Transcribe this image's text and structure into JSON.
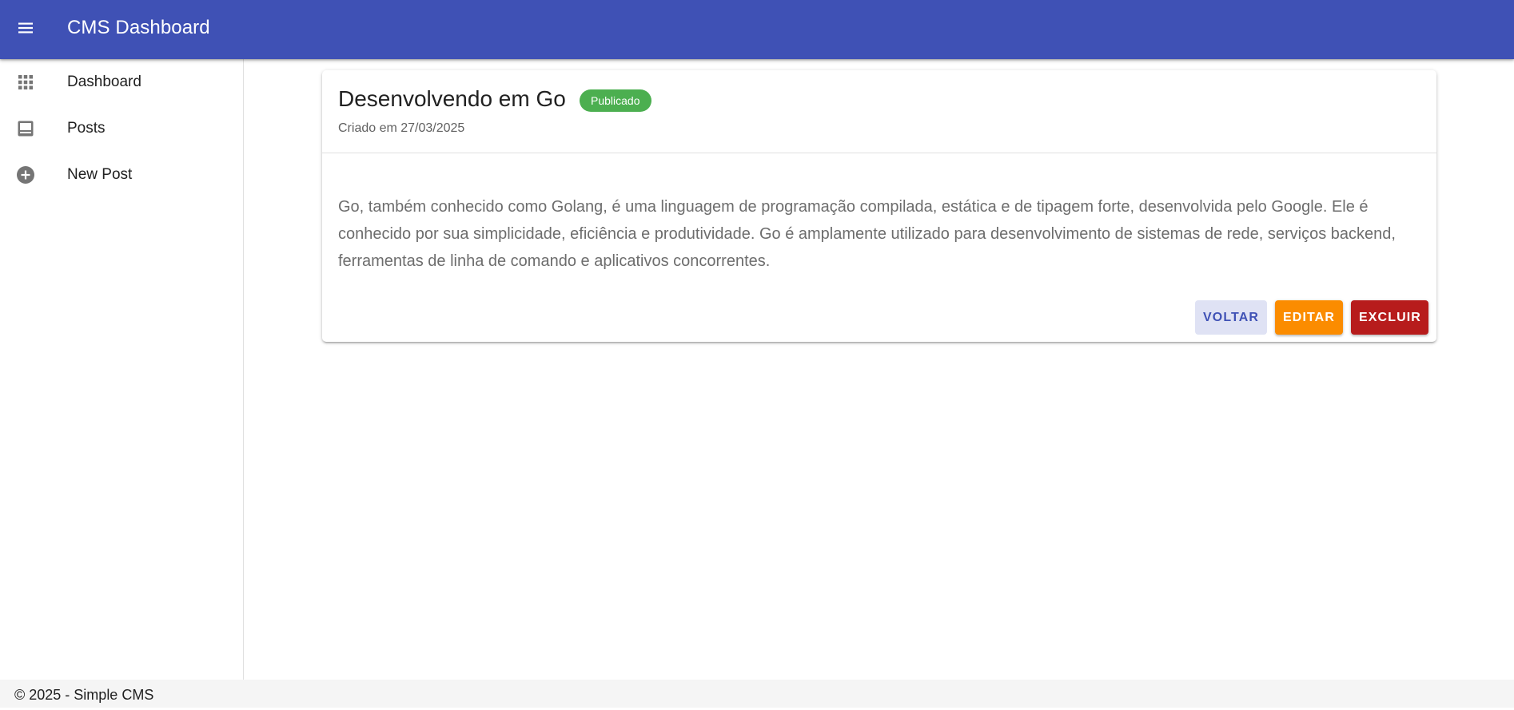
{
  "app_bar": {
    "menu_icon": "menu-icon",
    "title": "CMS Dashboard",
    "color": "#3f51b5"
  },
  "sidebar": {
    "items": [
      {
        "label": "Dashboard",
        "icon": "apps-grid-icon"
      },
      {
        "label": "Posts",
        "icon": "post-list-icon"
      },
      {
        "label": "New Post",
        "icon": "add-circle-icon"
      }
    ]
  },
  "post": {
    "title": "Desenvolvendo em Go",
    "status": "Publicado",
    "status_color": "#4caf50",
    "created": "Criado em 27/03/2025",
    "content": "Go, também conhecido como Golang, é uma linguagem de programação compilada, estática e de tipagem forte, desenvolvida pelo Google. Ele é conhecido por sua simplicidade, eficiência e produtividade. Go é amplamente utilizado para desenvolvimento de sistemas de rede, serviços backend, ferramentas de linha de comando e aplicativos concorrentes."
  },
  "actions": {
    "back_label": "VOLTAR",
    "edit_label": "EDITAR",
    "delete_label": "EXCLUIR",
    "edit_color": "#fb8c00",
    "delete_color": "#b71c1c"
  },
  "footer": {
    "text": "© 2025 - Simple CMS"
  }
}
